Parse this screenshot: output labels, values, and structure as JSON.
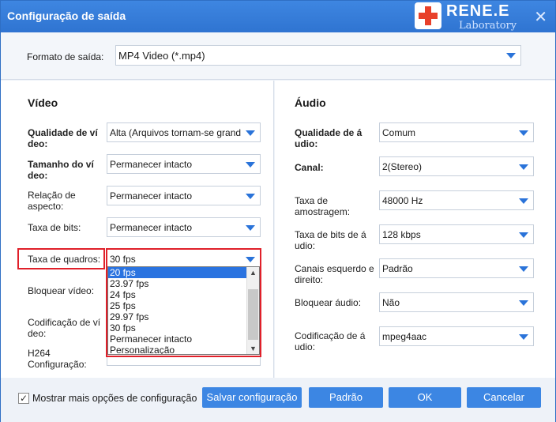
{
  "window": {
    "title": "Configuração de saída",
    "close_glyph": "✕",
    "logo_title": "RENE.E",
    "logo_subtitle": "Laboratory"
  },
  "format": {
    "label": "Formato de saída:",
    "value": "MP4 Video (*.mp4)"
  },
  "video": {
    "title": "Vídeo",
    "quality": {
      "label_1": "Qualidade de ví",
      "label_2": "deo:",
      "value": "Alta (Arquivos tornam-se grand"
    },
    "size": {
      "label_1": "Tamanho do ví",
      "label_2": "deo:",
      "value": "Permanecer intacto"
    },
    "aspect": {
      "label_1": "Relação de",
      "label_2": "aspecto:",
      "value": "Permanecer intacto"
    },
    "bitrate": {
      "label": "Taxa de bits:",
      "value": "Permanecer intacto"
    },
    "framerate": {
      "label": "Taxa de quadros:",
      "value": "30 fps",
      "options": [
        "20 fps",
        "23.97 fps",
        "24 fps",
        "25 fps",
        "29.97 fps",
        "30 fps",
        "Permanecer intacto",
        "Personalização"
      ]
    },
    "lock": {
      "label": "Bloquear vídeo:"
    },
    "codec": {
      "label_1": "Codificação de ví",
      "label_2": "deo:"
    },
    "h264": {
      "label_1": "H264",
      "label_2": "Configuração:"
    }
  },
  "audio": {
    "title": "Áudio",
    "quality": {
      "label_1": "Qualidade de á",
      "label_2": "udio:",
      "value": "Comum"
    },
    "channel": {
      "label": "Canal:",
      "value": "2(Stereo)"
    },
    "samplerate": {
      "label_1": "Taxa de",
      "label_2": "amostragem:",
      "value": "48000 Hz"
    },
    "bitrate": {
      "label_1": "Taxa de bits de á",
      "label_2": "udio:",
      "value": "128 kbps"
    },
    "lr": {
      "label_1": "Canais esquerdo e",
      "label_2": "direito:",
      "value": "Padrão"
    },
    "lock": {
      "label": "Bloquear áudio:",
      "value": "Não"
    },
    "codec": {
      "label_1": "Codificação de á",
      "label_2": "udio:",
      "value": "mpeg4aac"
    }
  },
  "footer": {
    "more_options_label": "Mostrar mais opções de configuração",
    "more_options_checked": true,
    "save_label": "Salvar configuração",
    "default_label": "Padrão",
    "ok_label": "OK",
    "cancel_label": "Cancelar"
  },
  "colors": {
    "accent": "#3c86e3",
    "highlight": "#e0202a",
    "selection": "#2a73e0"
  }
}
